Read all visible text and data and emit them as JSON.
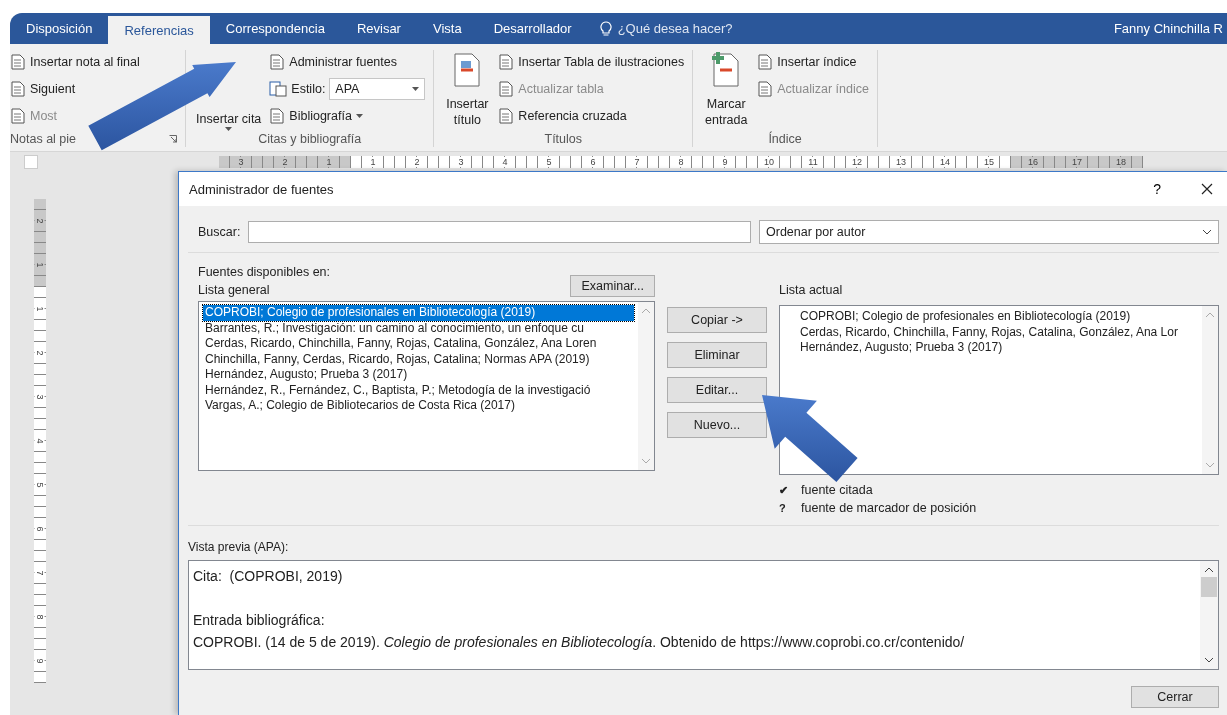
{
  "ribbon": {
    "tabs": [
      {
        "label": "Disposición",
        "selected": false
      },
      {
        "label": "Referencias",
        "selected": true
      },
      {
        "label": "Correspondencia",
        "selected": false
      },
      {
        "label": "Revisar",
        "selected": false
      },
      {
        "label": "Vista",
        "selected": false
      },
      {
        "label": "Desarrollador",
        "selected": false
      }
    ],
    "search_hint": "¿Qué desea hacer?",
    "user": "Fanny Chinchilla R",
    "groups": [
      {
        "label": "Notas al pie",
        "launcher": true,
        "items": [
          {
            "kind": "small",
            "label": "Insertar nota al final",
            "disabled": false
          },
          {
            "kind": "small",
            "label": "Siguient",
            "disabled": false
          },
          {
            "kind": "small",
            "label": "Most",
            "disabled": true
          }
        ]
      },
      {
        "label": "Citas y bibliografía",
        "items": [
          {
            "kind": "large_text",
            "label": "Insertar cita",
            "disabled": false,
            "menu": true
          },
          {
            "kind": "small",
            "label": "Administrar fuentes",
            "disabled": false
          },
          {
            "kind": "combo",
            "label": "Estilo:",
            "value": "APA",
            "disabled": false,
            "menu": true
          },
          {
            "kind": "small",
            "label": "Bibliografía",
            "disabled": false,
            "menu": true
          }
        ]
      },
      {
        "label": "Títulos",
        "items": [
          {
            "kind": "large",
            "label": "Insertar título",
            "disabled": false
          },
          {
            "kind": "small",
            "label": "Insertar Tabla de ilustraciones",
            "disabled": false
          },
          {
            "kind": "small",
            "label": "Actualizar tabla",
            "disabled": true
          },
          {
            "kind": "small",
            "label": "Referencia cruzada",
            "disabled": false
          }
        ]
      },
      {
        "label": "Índice",
        "items": [
          {
            "kind": "large",
            "label": "Marcar entrada",
            "disabled": false
          },
          {
            "kind": "small",
            "label": "Insertar índice",
            "disabled": false
          },
          {
            "kind": "small",
            "label": "Actualizar índice",
            "disabled": true
          }
        ]
      }
    ]
  },
  "horizontal_ruler": [
    {
      "shaded": true,
      "labels": [
        "3",
        "2",
        "1"
      ]
    },
    {
      "shaded": false,
      "labels": [
        "1",
        "2",
        "3",
        "4",
        "5",
        "6",
        "7",
        "8",
        "9",
        "10",
        "11",
        "12",
        "13",
        "14",
        "15"
      ]
    },
    {
      "shaded": true,
      "labels": [
        "16",
        "17",
        "18"
      ]
    }
  ],
  "vertical_ruler": [
    {
      "shaded": true,
      "labels": [
        "2",
        "1"
      ]
    },
    {
      "shaded": false,
      "labels": [
        "1",
        "2",
        "3",
        "4",
        "5",
        "6",
        "7",
        "8",
        "9"
      ]
    }
  ],
  "dialog": {
    "title": "Administrador de fuentes",
    "help": "?",
    "search": {
      "label": "Buscar:"
    },
    "sort": {
      "value": "Ordenar por autor"
    },
    "available_label": "Fuentes disponibles en:",
    "browse_button": "Examinar...",
    "master_list": {
      "label": "Lista general",
      "items": [
        {
          "text": "COPROBI; Colegio de profesionales en Bibliotecología (2019)",
          "selected": true
        },
        {
          "text": "Barrantes, R.; Investigación: un camino al conocimiento, un enfoque cu",
          "selected": false
        },
        {
          "text": "Cerdas, Ricardo, Chinchilla, Fanny, Rojas, Catalina, González, Ana Loren",
          "selected": false
        },
        {
          "text": "Chinchilla, Fanny, Cerdas, Ricardo, Rojas, Catalina; Normas APA (2019)",
          "selected": false
        },
        {
          "text": "Hernández, Augusto; Prueba 3 (2017)",
          "selected": false
        },
        {
          "text": "Hernández, R., Fernández, C., Baptista, P.; Metodogía de la investigació",
          "selected": false
        },
        {
          "text": "Vargas, A.; Colegio de Bibliotecarios de Costa Rica (2017)",
          "selected": false
        }
      ]
    },
    "actions": [
      "Copiar ->",
      "Eliminar",
      "Editar...",
      "Nuevo..."
    ],
    "current_list": {
      "label": "Lista actual",
      "items": [
        {
          "text": "COPROBI; Colegio de profesionales en Bibliotecología (2019)",
          "selected": false
        },
        {
          "text": "Cerdas, Ricardo, Chinchilla, Fanny, Rojas, Catalina, González, Ana Lor",
          "selected": false
        },
        {
          "text": "Hernández, Augusto; Prueba 3 (2017)",
          "selected": false
        }
      ]
    },
    "legend": [
      {
        "symbol": "✔",
        "text": "fuente citada"
      },
      {
        "symbol": "?",
        "text": "fuente de marcador de posición"
      }
    ],
    "preview": {
      "label": "Vista previa (APA):",
      "citation": "Cita:  (COPROBI, 2019)",
      "entry_heading": "Entrada bibliográfica:",
      "entry": "COPROBI. (14 de 5 de 2019). *Colegio de profesionales en Bibliotecología*. Obtenido de https://www.coprobi.co.cr/contenido/"
    },
    "close_button": "Cerrar"
  }
}
